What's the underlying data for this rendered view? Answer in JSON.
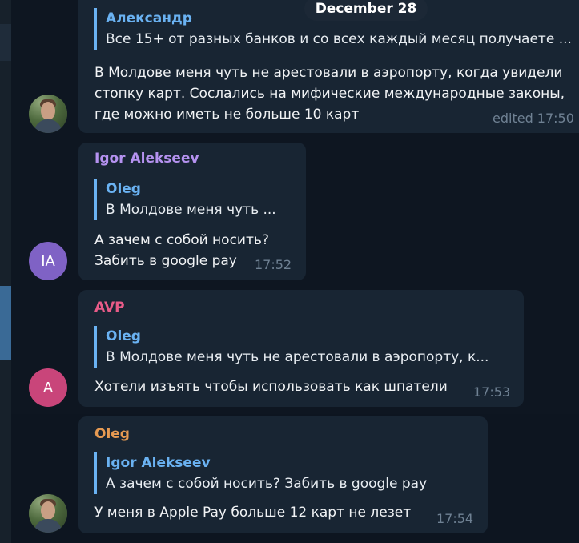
{
  "date_separator": "December 28",
  "messages": [
    {
      "sender": "",
      "reply_to": {
        "name": "Александр",
        "text": "Все 15+ от разных банков и со всех каждый месяц получаете ..."
      },
      "text_lines": [
        "В Молдове меня чуть не арестовали в аэропорту, когда увидели",
        "стопку карт. Сослались на мифические международные законы,",
        "где можно иметь не больше 10 карт"
      ],
      "time": "edited 17:50",
      "avatar": {
        "type": "photo",
        "icon": "user-photo"
      }
    },
    {
      "sender": "Igor Alekseev",
      "sender_color": "#b592f0",
      "reply_to": {
        "name": "Oleg",
        "text": "В Молдове меня чуть ..."
      },
      "text_lines": [
        "А зачем с собой носить?",
        "Забить в google pay"
      ],
      "time": "17:52",
      "avatar": {
        "type": "initials",
        "initials": "IA",
        "color": "#7f62c5"
      }
    },
    {
      "sender": "AVP",
      "sender_color": "#e85b88",
      "reply_to": {
        "name": "Oleg",
        "text": "В Молдове меня чуть не арестовали в аэропорту, к..."
      },
      "text_lines": [
        "Хотели изъять чтобы использовать как шпатели"
      ],
      "time": "17:53",
      "avatar": {
        "type": "initials",
        "initials": "A",
        "color": "#c9457a"
      }
    },
    {
      "sender": "Oleg",
      "sender_color": "#e69a52",
      "reply_to": {
        "name": "Igor Alekseev",
        "text": "А зачем с собой носить? Забить в google pay"
      },
      "text_lines": [
        "У меня в Apple Pay больше 12 карт не лезет"
      ],
      "time": "17:54",
      "avatar": {
        "type": "photo",
        "icon": "user-photo"
      }
    }
  ]
}
